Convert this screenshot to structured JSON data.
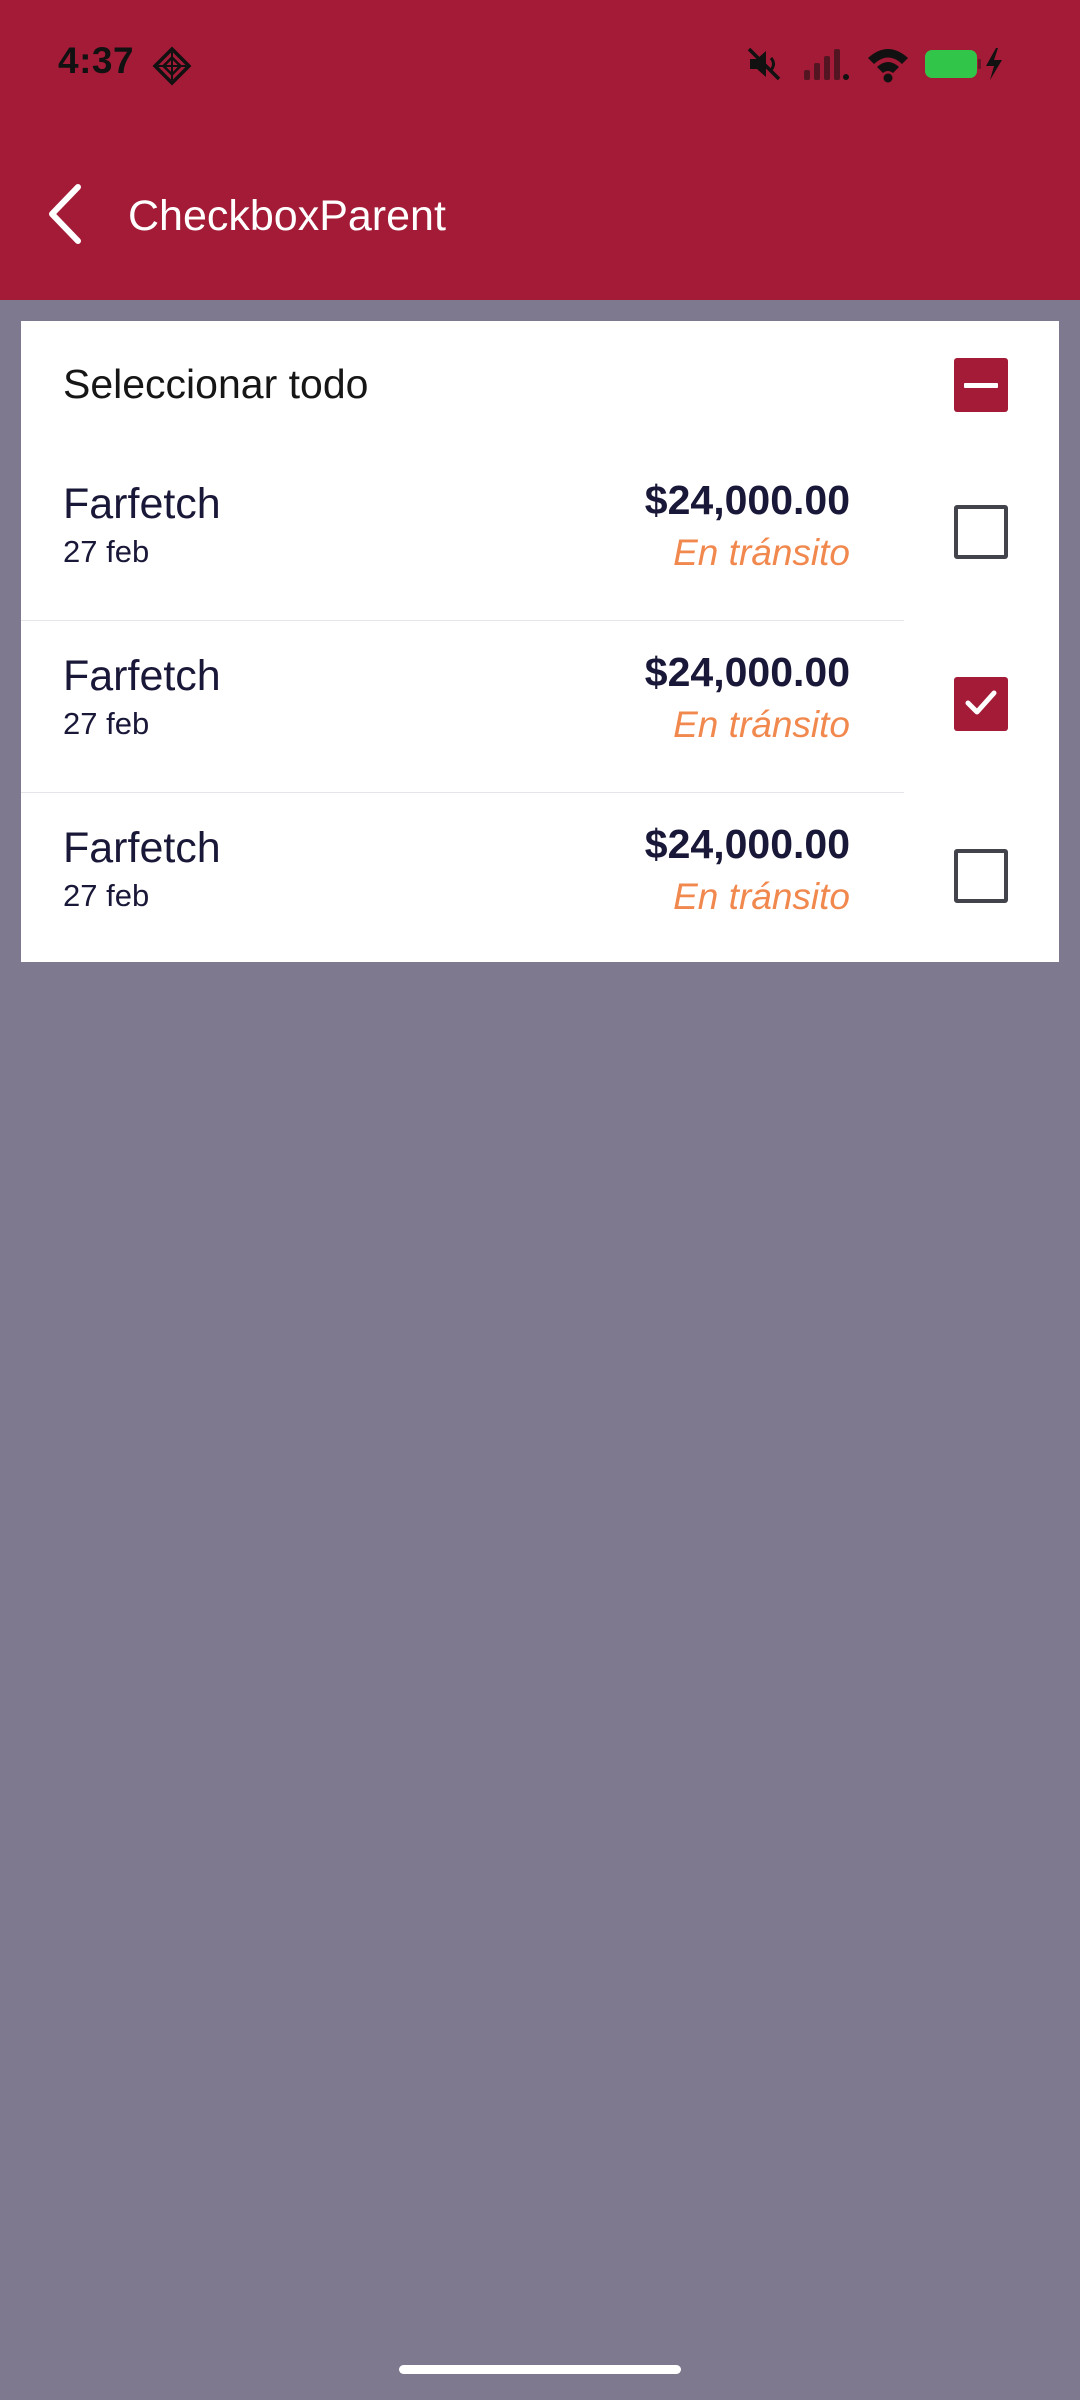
{
  "status_bar": {
    "time": "4:37",
    "icons": [
      "app-grid-icon",
      "silent-mode-icon",
      "signal-icon",
      "wifi-icon",
      "battery-charging-icon"
    ]
  },
  "nav": {
    "title": "CheckboxParent",
    "back_icon": "chevron-left-icon"
  },
  "select_all": {
    "label": "Seleccionar todo",
    "state": "indeterminate"
  },
  "items": [
    {
      "merchant": "Farfetch",
      "date": "27 feb",
      "amount": "$24,000.00",
      "status": "En tránsito",
      "checked": false
    },
    {
      "merchant": "Farfetch",
      "date": "27 feb",
      "amount": "$24,000.00",
      "status": "En tránsito",
      "checked": true
    },
    {
      "merchant": "Farfetch",
      "date": "27 feb",
      "amount": "$24,000.00",
      "status": "En tránsito",
      "checked": false
    }
  ],
  "colors": {
    "brand": "#a31b36",
    "overlay": "#7e798e",
    "status_text": "#f1884e",
    "primary_text": "#1a1838"
  }
}
